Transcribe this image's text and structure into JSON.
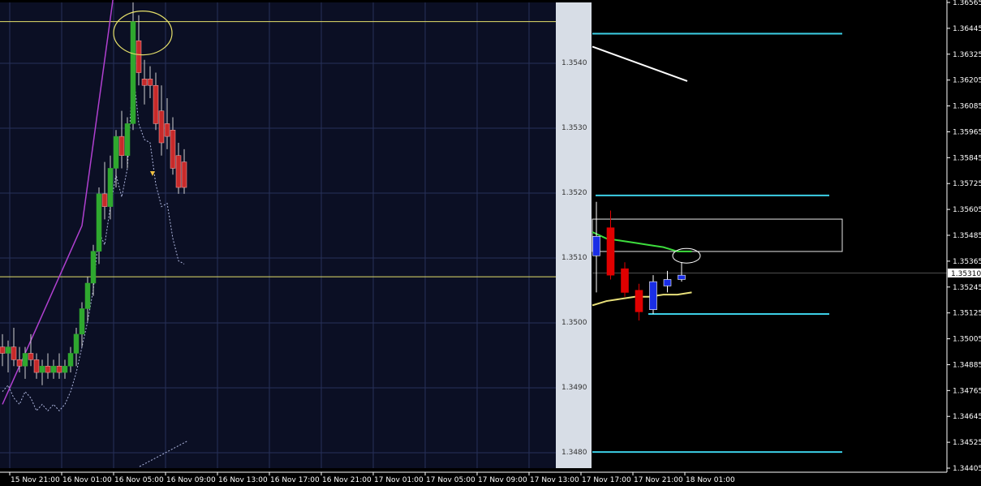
{
  "colors": {
    "chart_bg": "#000000",
    "inset_bg": "#0b0f24",
    "inset_grid": "#27305a",
    "inset_axis_bg": "#d7dde6",
    "bull_inset": "#2fa82f",
    "bear_inset": "#c72a2a",
    "bull_main": "#1a2ee6",
    "bear_main": "#e00000",
    "level_line": "#3ccfe6",
    "zone_box": "#e6e6e6",
    "ma_green": "#3ddc3d",
    "ma_yellow": "#e8e07a",
    "ma_purple": "#b040d0",
    "ma_white_dotted": "#b0b8e0",
    "trend_white": "#ffffff",
    "annotation_yellow": "#e6e06a",
    "axis_text": "#ffffff",
    "price_tag_bg": "#ffffff"
  },
  "axis": {
    "price_ticks": [
      "1.36565",
      "1.36445",
      "1.36325",
      "1.36205",
      "1.36085",
      "1.35965",
      "1.35845",
      "1.35725",
      "1.35605",
      "1.35485",
      "1.35365",
      "1.35245",
      "1.35125",
      "1.35005",
      "1.34885",
      "1.34765",
      "1.34645",
      "1.34525",
      "1.34405"
    ],
    "current_price": "1.35310",
    "time_ticks": [
      "15 Nov 21:00",
      "16 Nov 01:00",
      "16 Nov 05:00",
      "16 Nov 09:00",
      "16 Nov 13:00",
      "16 Nov 17:00",
      "16 Nov 21:00",
      "17 Nov 01:00",
      "17 Nov 05:00",
      "17 Nov 09:00",
      "17 Nov 13:00",
      "17 Nov 17:00",
      "17 Nov 21:00",
      "18 Nov 01:00"
    ]
  },
  "inset": {
    "price_labels": [
      "1.3540",
      "1.3530",
      "1.3520",
      "1.3510",
      "1.3500",
      "1.3490",
      "1.3480"
    ]
  },
  "chart_data": [
    {
      "type": "candlestick",
      "name_note": "",
      "y_axis_ticks": [
        "1.36565",
        "1.36445",
        "1.36325",
        "1.36205",
        "1.36085",
        "1.35965",
        "1.35845",
        "1.35725",
        "1.35605",
        "1.35485",
        "1.35365",
        "1.35245",
        "1.35125",
        "1.35005",
        "1.34885",
        "1.34765",
        "1.34645",
        "1.34525",
        "1.34405"
      ],
      "x_axis_ticks": [
        "17 Nov 17:00",
        "17 Nov 21:00",
        "18 Nov 01:00"
      ],
      "ylim": [
        1.344,
        1.366
      ],
      "current_price": 1.3531,
      "candles": [
        {
          "t": 0,
          "o": 1.3539,
          "h": 1.3564,
          "l": 1.3522,
          "c": 1.3548
        },
        {
          "t": 1,
          "o": 1.3552,
          "h": 1.356,
          "l": 1.3528,
          "c": 1.353
        },
        {
          "t": 2,
          "o": 1.3533,
          "h": 1.3536,
          "l": 1.352,
          "c": 1.3522
        },
        {
          "t": 3,
          "o": 1.3523,
          "h": 1.3526,
          "l": 1.3509,
          "c": 1.3513
        },
        {
          "t": 4,
          "o": 1.3514,
          "h": 1.353,
          "l": 1.3512,
          "c": 1.3527
        },
        {
          "t": 5,
          "o": 1.3525,
          "h": 1.3532,
          "l": 1.3522,
          "c": 1.3528
        },
        {
          "t": 6,
          "o": 1.3528,
          "h": 1.3536,
          "l": 1.3527,
          "c": 1.353
        }
      ],
      "moving_averages": [
        {
          "color_key": "ma_green",
          "points": [
            [
              0,
              1.355
            ],
            [
              1,
              1.3547
            ],
            [
              2,
              1.3546
            ],
            [
              3,
              1.3545
            ],
            [
              4,
              1.3544
            ],
            [
              5,
              1.3543
            ],
            [
              6,
              1.3541
            ],
            [
              7,
              1.3541
            ]
          ]
        },
        {
          "color_key": "ma_yellow",
          "points": [
            [
              0,
              1.3516
            ],
            [
              1,
              1.3518
            ],
            [
              2,
              1.3519
            ],
            [
              3,
              1.352
            ],
            [
              4,
              1.352
            ],
            [
              5,
              1.3521
            ],
            [
              6,
              1.3521
            ],
            [
              7,
              1.3522
            ]
          ]
        }
      ],
      "horizontal_levels": [
        1.3642,
        1.3567,
        1.3512,
        1.3448
      ],
      "zone": {
        "top": 1.3556,
        "bottom": 1.3541
      },
      "trendline_white": [
        [
          1.3636
        ],
        [
          1.362
        ]
      ]
    },
    {
      "type": "candlestick",
      "name_note": "",
      "y_axis_ticks": [
        "1.3540",
        "1.3530",
        "1.3520",
        "1.3510",
        "1.3500",
        "1.3490",
        "1.3480"
      ],
      "x_axis_ticks": [
        "15 Nov 21:00",
        "16 Nov 01:00",
        "16 Nov 05:00",
        "16 Nov 09:00",
        "16 Nov 13:00",
        "16 Nov 17:00",
        "16 Nov 21:00",
        "17 Nov 01:00",
        "17 Nov 05:00",
        "17 Nov 09:00",
        "17 Nov 13:00"
      ],
      "ylim": [
        1.3475,
        1.3548
      ],
      "horizontal_levels": [
        1.3545,
        1.3505
      ],
      "candles": [
        {
          "o": 1.3494,
          "h": 1.3496,
          "l": 1.3491,
          "c": 1.3493
        },
        {
          "o": 1.3493,
          "h": 1.3495,
          "l": 1.349,
          "c": 1.3494
        },
        {
          "o": 1.3494,
          "h": 1.3497,
          "l": 1.3491,
          "c": 1.3492
        },
        {
          "o": 1.3492,
          "h": 1.3494,
          "l": 1.349,
          "c": 1.3491
        },
        {
          "o": 1.3491,
          "h": 1.3494,
          "l": 1.3489,
          "c": 1.3493
        },
        {
          "o": 1.3493,
          "h": 1.3496,
          "l": 1.3491,
          "c": 1.3492
        },
        {
          "o": 1.3492,
          "h": 1.3493,
          "l": 1.3489,
          "c": 1.349
        },
        {
          "o": 1.349,
          "h": 1.3492,
          "l": 1.3488,
          "c": 1.3491
        },
        {
          "o": 1.3491,
          "h": 1.3493,
          "l": 1.3489,
          "c": 1.349
        },
        {
          "o": 1.349,
          "h": 1.3492,
          "l": 1.3489,
          "c": 1.3491
        },
        {
          "o": 1.3491,
          "h": 1.3493,
          "l": 1.3489,
          "c": 1.349
        },
        {
          "o": 1.349,
          "h": 1.3492,
          "l": 1.3489,
          "c": 1.3491
        },
        {
          "o": 1.3491,
          "h": 1.3494,
          "l": 1.349,
          "c": 1.3493
        },
        {
          "o": 1.3493,
          "h": 1.3497,
          "l": 1.3491,
          "c": 1.3496
        },
        {
          "o": 1.3496,
          "h": 1.3501,
          "l": 1.3494,
          "c": 1.35
        },
        {
          "o": 1.35,
          "h": 1.3505,
          "l": 1.3498,
          "c": 1.3504
        },
        {
          "o": 1.3504,
          "h": 1.351,
          "l": 1.3502,
          "c": 1.3509
        },
        {
          "o": 1.3509,
          "h": 1.3519,
          "l": 1.3507,
          "c": 1.3518
        },
        {
          "o": 1.3518,
          "h": 1.3523,
          "l": 1.3514,
          "c": 1.3516
        },
        {
          "o": 1.3516,
          "h": 1.3524,
          "l": 1.3514,
          "c": 1.3522
        },
        {
          "o": 1.3522,
          "h": 1.3528,
          "l": 1.3519,
          "c": 1.3527
        },
        {
          "o": 1.3527,
          "h": 1.3531,
          "l": 1.3522,
          "c": 1.3524
        },
        {
          "o": 1.3524,
          "h": 1.353,
          "l": 1.3522,
          "c": 1.3529
        },
        {
          "o": 1.3529,
          "h": 1.3548,
          "l": 1.3528,
          "c": 1.3545
        },
        {
          "o": 1.3542,
          "h": 1.3546,
          "l": 1.3535,
          "c": 1.3537
        },
        {
          "o": 1.3536,
          "h": 1.3539,
          "l": 1.3532,
          "c": 1.3535
        },
        {
          "o": 1.3536,
          "h": 1.3538,
          "l": 1.3533,
          "c": 1.3535
        },
        {
          "o": 1.3535,
          "h": 1.3537,
          "l": 1.3528,
          "c": 1.3529
        },
        {
          "o": 1.3531,
          "h": 1.3535,
          "l": 1.3524,
          "c": 1.3526
        },
        {
          "o": 1.3529,
          "h": 1.3533,
          "l": 1.3525,
          "c": 1.3527
        },
        {
          "o": 1.3528,
          "h": 1.353,
          "l": 1.3521,
          "c": 1.3522
        },
        {
          "o": 1.3524,
          "h": 1.3526,
          "l": 1.3518,
          "c": 1.3519
        },
        {
          "o": 1.3523,
          "h": 1.3525,
          "l": 1.3518,
          "c": 1.3519
        }
      ]
    }
  ]
}
